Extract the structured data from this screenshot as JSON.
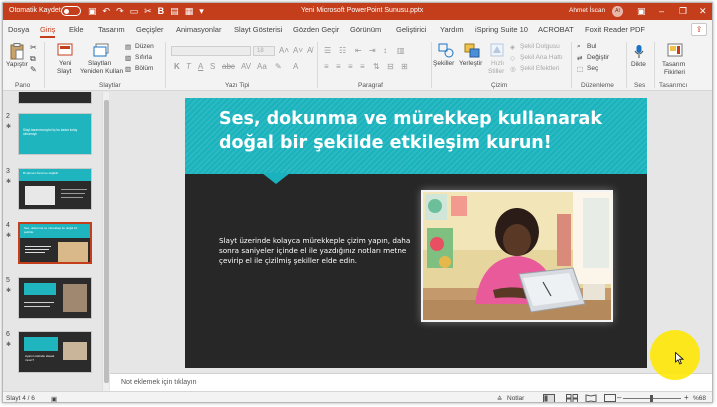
{
  "titlebar": {
    "autosave_label": "Otomatik Kaydet",
    "doc_title": "Yeni Microsoft PowerPoint Sunusu.pptx",
    "user_name": "Ahmet İscan",
    "avatar_initials": "AI",
    "accent_color": "#c43e1c"
  },
  "menu": {
    "tabs": [
      "Dosya",
      "Giriş",
      "Ekle",
      "Tasarım",
      "Geçişler",
      "Animasyonlar",
      "Slayt Gösterisi",
      "Gözden Geçir",
      "Görünüm",
      "Geliştirici",
      "Yardım",
      "iSpring Suite 10",
      "ACROBAT",
      "Foxit Reader PDF"
    ],
    "active_tab": "Giriş"
  },
  "ribbon": {
    "pano": {
      "label": "Pano",
      "paste": "Yapıştır"
    },
    "slides": {
      "label": "Slaytlar",
      "new_slide_1": "Yeni",
      "new_slide_2": "Slayt",
      "reuse_1": "Slaytları",
      "reuse_2": "Yeniden Kullan",
      "layout": "Düzen",
      "reset": "Sıfırla",
      "section": "Bölüm"
    },
    "font": {
      "label": "Yazı Tipi",
      "size": "18"
    },
    "paragraph": {
      "label": "Paragraf"
    },
    "drawing": {
      "label": "Çizim",
      "shapes": "Şekiller",
      "arrange": "Yerleştir",
      "quick_styles_1": "Hızlı",
      "quick_styles_2": "Stiller",
      "fill": "Şekil Dolgusu",
      "outline": "Şekil Ana Hattı",
      "effects": "Şekil Efektleri"
    },
    "editing": {
      "label": "Düzenleme",
      "find": "Bul",
      "replace": "Değiştir",
      "select": "Seç"
    },
    "voice": {
      "label": "Ses",
      "dictate": "Dikte"
    },
    "designer": {
      "label": "Tasarımcı",
      "ideas_1": "Tasarım",
      "ideas_2": "Fikirleri"
    }
  },
  "thumbnails": [
    {
      "number": "2",
      "title": "Slayt tasarımcısıyla hiç bu kadar kolay olmamıştı",
      "selected": false
    },
    {
      "number": "3",
      "title": "Bi şikmes Rezerve değildir",
      "selected": false
    },
    {
      "number": "4",
      "title": "Ses, dokunma ve mürekkep ile doğal bir şekilde",
      "selected": true
    },
    {
      "number": "5",
      "title": "",
      "selected": false
    },
    {
      "number": "6",
      "title": "Ayarım üstinde Havalı mısın?",
      "selected": false
    }
  ],
  "slide": {
    "title": "Ses, dokunma ve mürekkep kullanarak doğal bir şekilde etkileşim kurun!",
    "body": "Slayt üzerinde kolayca mürekkeple çizim yapın, daha sonra saniyeler içinde el ile yazdığınız notları metne çevirip el ile çizilmiş şekiller elde edin.",
    "band_color": "#1ab3bd",
    "background_color": "#272727"
  },
  "notes": {
    "placeholder": "Not eklemek için tıklayın"
  },
  "status": {
    "slide_counter": "Slayt 4 / 6",
    "notes_button": "Notlar",
    "zoom": "%68"
  }
}
